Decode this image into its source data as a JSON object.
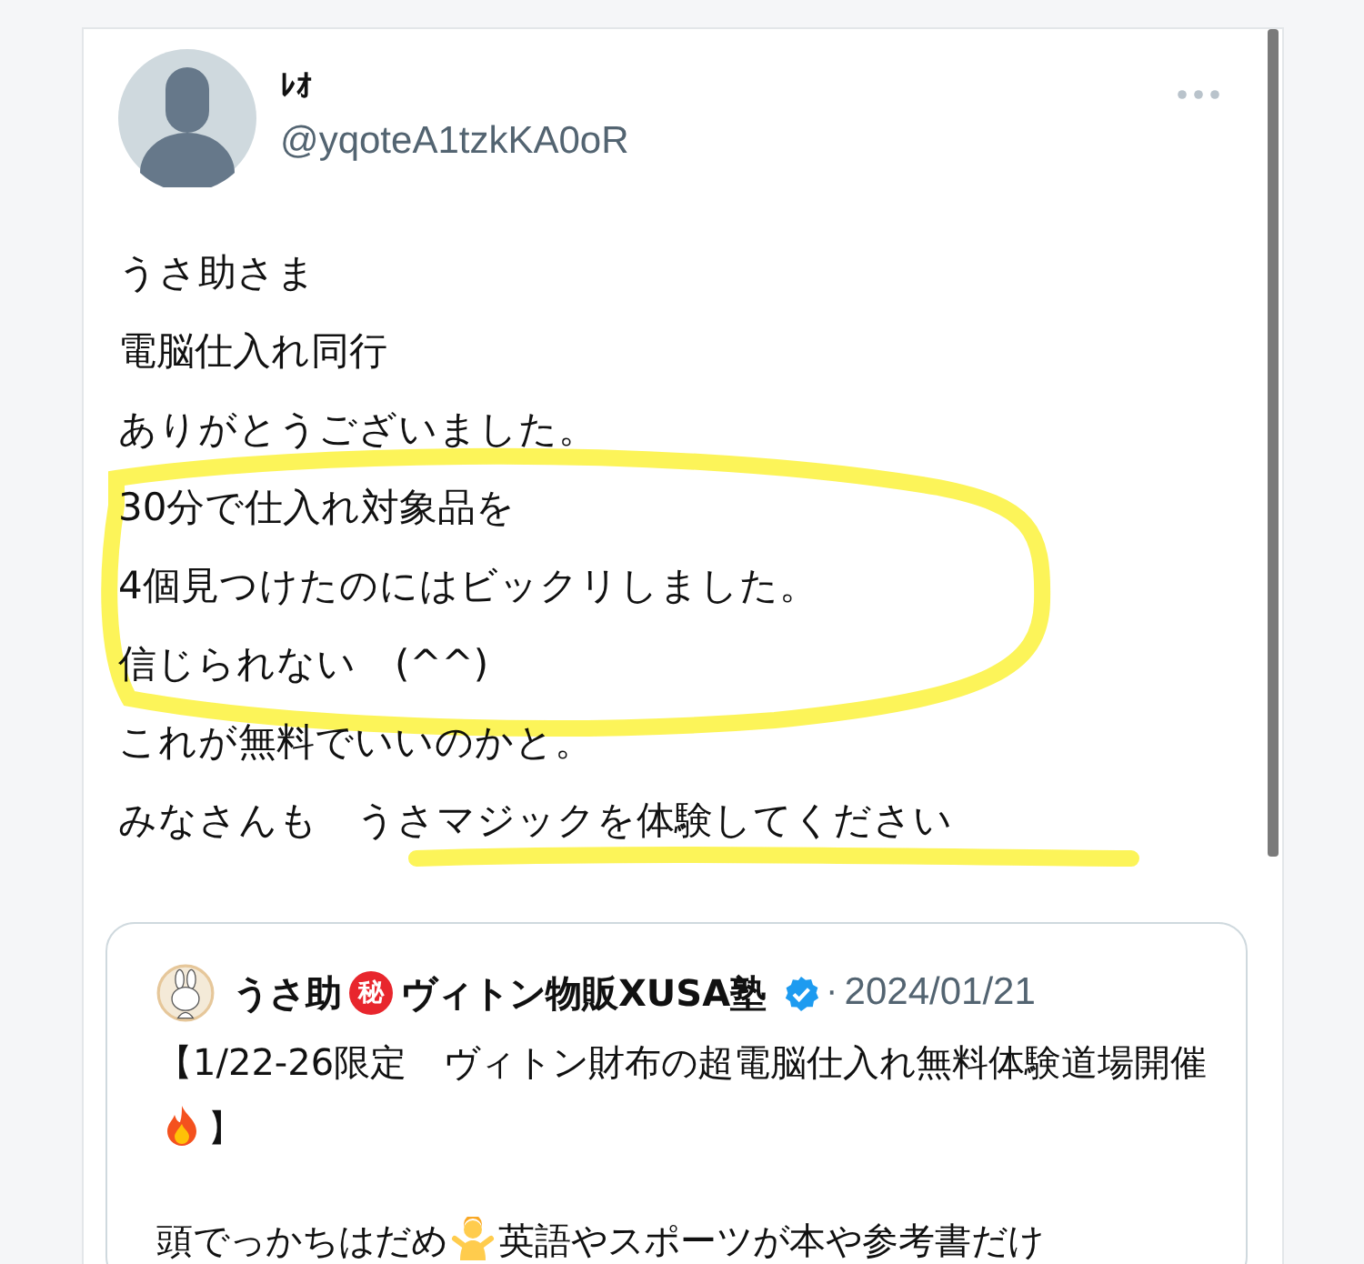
{
  "tweet": {
    "author": {
      "name": "ﾚｵ",
      "handle": "@yqoteA1tzkKA0oR"
    },
    "lines": [
      "うさ助さま",
      "電脳仕入れ同行",
      "ありがとうございました。",
      "30分で仕入れ対象品を",
      "4個見つけたのにはビックリしました。",
      "信じられない　(^^)",
      "これが無料でいいのかと。",
      "みなさんも　うさマジックを体験してください"
    ],
    "quoted": {
      "name_before": "うさ助",
      "badge": "秘",
      "name_after": "ヴィトン物販XUSA塾",
      "verified": true,
      "separator": "·",
      "date": "2024/01/21",
      "paragraphs": [
        {
          "before": "【1/22-26限定　ヴィトン財布の超電脳仕入れ無料体験道場開催",
          "after": "】"
        },
        {
          "before": "頭でっかちはだめ",
          "after": "英語やスポーツが本や参考書だけ"
        }
      ]
    }
  }
}
